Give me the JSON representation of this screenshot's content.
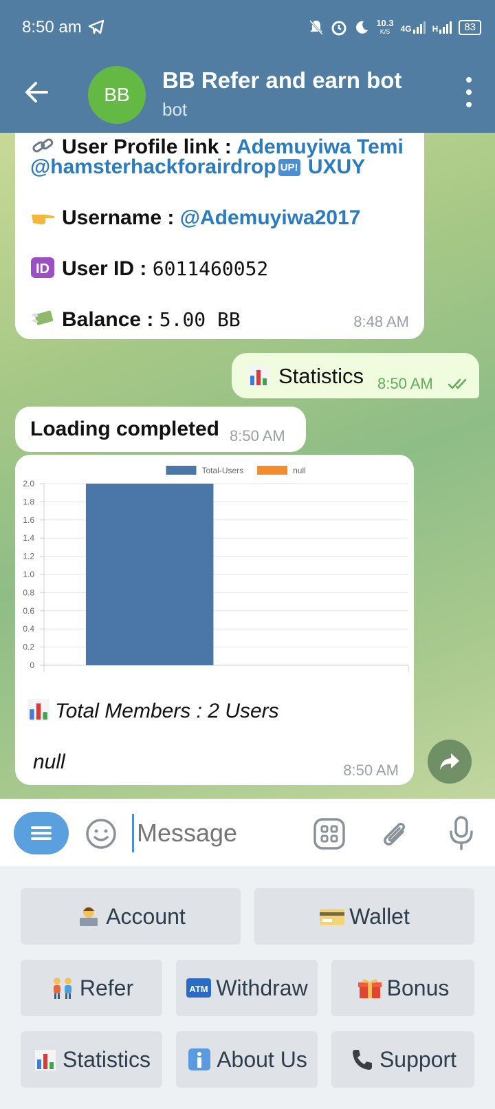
{
  "status_bar": {
    "time": "8:50 am",
    "net_speed": "10.3",
    "net_unit": "K/S",
    "network": "4G",
    "network_h": "H",
    "battery": "83"
  },
  "header": {
    "avatar_initials": "BB",
    "title": "BB Refer and earn bot",
    "subtitle": "bot"
  },
  "profile_message": {
    "link_label": "User Profile link : ",
    "link_value": "Ademuyiwa Temi",
    "handle": "@hamsterhackforairdrop",
    "handle_badge": "UP!",
    "handle_suffix": " UXUY",
    "username_label": "Username : ",
    "username_value": "@Ademuyiwa2017",
    "user_id_label": "User ID : ",
    "user_id_value": "6011460052",
    "balance_label": "Balance : ",
    "balance_value": "5.00 BB",
    "time": "8:48 AM"
  },
  "outgoing_message": {
    "text": "Statistics",
    "time": "8:50 AM"
  },
  "loading_message": {
    "text": "Loading completed",
    "time": "8:50 AM"
  },
  "chart_message": {
    "caption_members": "Total Members : 2 Users",
    "caption_null": "null",
    "time": "8:50 AM"
  },
  "chart_data": {
    "type": "bar",
    "categories": [
      ""
    ],
    "series": [
      {
        "name": "Total-Users",
        "values": [
          2
        ],
        "color": "#4a76a8"
      },
      {
        "name": "null",
        "values": [
          0
        ],
        "color": "#f28c2c"
      }
    ],
    "ylim": [
      0,
      2.0
    ],
    "yticks": [
      "0",
      "0.2",
      "0.4",
      "0.6",
      "0.8",
      "1.0",
      "1.2",
      "1.4",
      "1.6",
      "1.8",
      "2.0"
    ],
    "legend": "top",
    "grid": true
  },
  "input": {
    "placeholder": "Message"
  },
  "keyboard": {
    "account": "Account",
    "wallet": "Wallet",
    "refer": "Refer",
    "withdraw": "Withdraw",
    "bonus": "Bonus",
    "statistics": "Statistics",
    "about": "About Us",
    "support": "Support"
  },
  "colors": {
    "header": "#517da2",
    "outgoing_bubble": "#effdde",
    "link": "#2a7bc0",
    "keyboard_button": "#dfe3e7"
  }
}
